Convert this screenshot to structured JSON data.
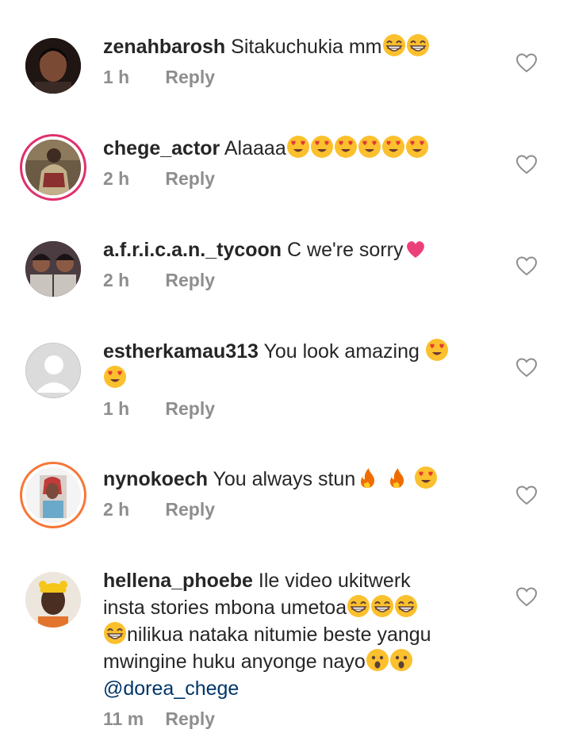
{
  "comments": [
    {
      "username": "zenahbarosh",
      "text": "Sitakuchukia mm",
      "emojis": [
        "grin",
        "grin"
      ],
      "time": "1 h",
      "reply_label": "Reply",
      "story_ring": false,
      "avatar": "photo"
    },
    {
      "username": "chege_actor",
      "text": "Alaaaa",
      "emojis": [
        "heart-eyes",
        "heart-eyes",
        "heart-eyes",
        "heart-eyes",
        "heart-eyes",
        "heart-eyes"
      ],
      "time": "2 h",
      "reply_label": "Reply",
      "story_ring": true,
      "avatar": "photo"
    },
    {
      "username": "a.f.r.i.c.a.n._tycoon",
      "text": "C we're sorry",
      "emojis": [
        "pink-heart"
      ],
      "time": "2 h",
      "reply_label": "Reply",
      "story_ring": false,
      "avatar": "photo"
    },
    {
      "username": "estherkamau313",
      "text": "You look amazing",
      "emojis": [
        "heart-eyes",
        "heart-eyes"
      ],
      "time": "1 h",
      "reply_label": "Reply",
      "story_ring": false,
      "avatar": "default"
    },
    {
      "username": "nynokoech",
      "text": "You always stun",
      "emojis": [
        "fire",
        "fire",
        "heart-eyes"
      ],
      "time": "2 h",
      "reply_label": "Reply",
      "story_ring": true,
      "avatar": "photo"
    },
    {
      "username": "hellena_phoebe",
      "text_line1": "Ile video ukitwerk",
      "text_line2": "insta stories mbona umetoa",
      "text_line3": "nilikua nataka nitumie beste yangu",
      "text_line4": "mwingine huku anyonge nayo",
      "mention": "@dorea_chege",
      "emojis_line2": [
        "grin",
        "grin",
        "grin"
      ],
      "emojis_line3": [
        "grin"
      ],
      "emojis_line4": [
        "surprised",
        "surprised"
      ],
      "time": "11 m",
      "reply_label": "Reply",
      "story_ring": false,
      "avatar": "photo"
    }
  ],
  "icons": {
    "like": "heart-outline-icon"
  },
  "colors": {
    "username": "#262626",
    "meta": "#8e8e8e",
    "mention": "#003569",
    "story_ring": "#e1306c"
  }
}
